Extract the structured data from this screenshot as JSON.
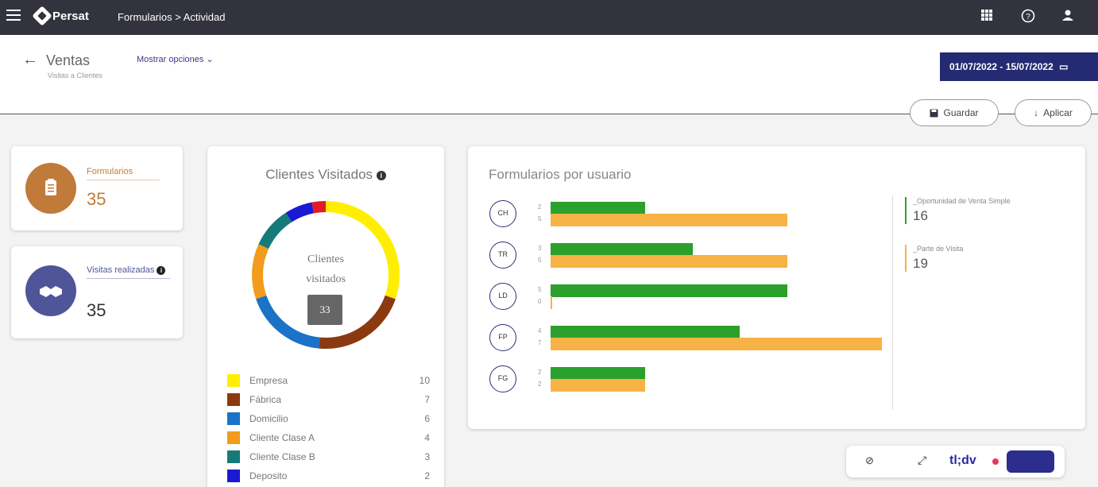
{
  "topbar": {
    "brand": "Persat",
    "breadcrumb": "Formularios > Actividad",
    "icons": [
      "menu-icon",
      "apps-grid-icon",
      "help-icon",
      "user-icon"
    ]
  },
  "header": {
    "title": "Ventas",
    "subtitle": "Visitas a Clientes",
    "show_options": "Mostrar opciones",
    "date_range": "01/07/2022 - 15/07/2022",
    "save_label": "Guardar",
    "apply_label": "Aplicar"
  },
  "kpis": [
    {
      "label": "Formularios",
      "value": "35",
      "icon": "clipboard-icon",
      "color": "#c07a3a"
    },
    {
      "label": "Visitas realizadas",
      "value": "35",
      "icon": "handshake-icon",
      "color": "#50559a"
    }
  ],
  "donut": {
    "title": "Clientes Visitados",
    "center_label_1": "Clientes",
    "center_label_2": "visitados",
    "center_value": "33",
    "items": [
      {
        "label": "Empresa",
        "count": 10,
        "color": "#ffee00"
      },
      {
        "label": "Fábrica",
        "count": 7,
        "color": "#8b3a0f"
      },
      {
        "label": "Domicilio",
        "count": 6,
        "color": "#1a73c7"
      },
      {
        "label": "Cliente Clase A",
        "count": 4,
        "color": "#f29b1c"
      },
      {
        "label": "Cliente Clase B",
        "count": 3,
        "color": "#167b78"
      },
      {
        "label": "Deposito",
        "count": 2,
        "color": "#1a1ad4"
      },
      {
        "label": "",
        "count": 1,
        "color": "#e31b23"
      }
    ]
  },
  "chart_data": {
    "type": "bar",
    "title": "Formularios por usuario",
    "categories": [
      "CH",
      "TR",
      "LD",
      "FP",
      "FG"
    ],
    "series": [
      {
        "name": "_Oportunidad de Venta Simple",
        "values": [
          2,
          3,
          5,
          4,
          2
        ],
        "color": "#2ca02c"
      },
      {
        "name": "_Parte de Visita",
        "values": [
          5,
          5,
          0,
          7,
          2
        ],
        "color": "#f7b345"
      }
    ],
    "totals": [
      16,
      19
    ]
  },
  "tldv": {
    "brand": "tl;dv"
  }
}
